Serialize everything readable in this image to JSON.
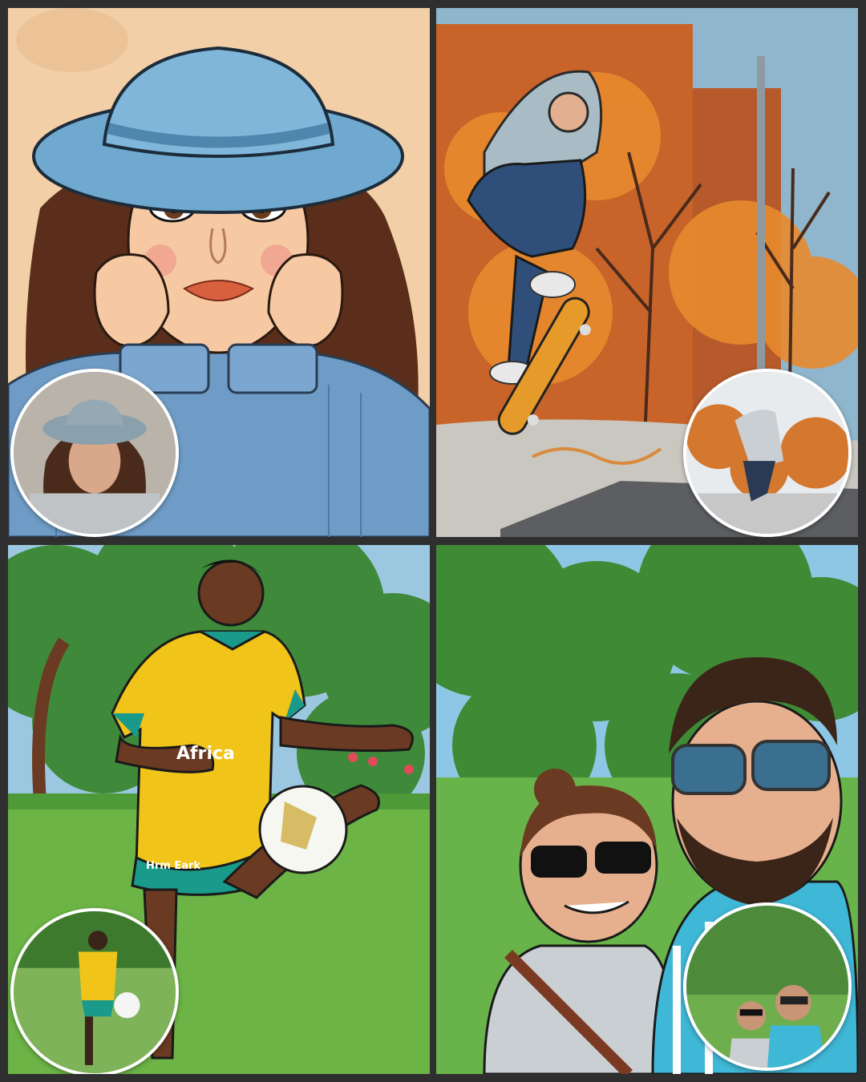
{
  "panels": [
    {
      "subject": "woman-in-blue-hat",
      "background": "#f2cfa6",
      "accent": "#6fa9cf"
    },
    {
      "subject": "skateboarder-autumn",
      "background": "#d9772a",
      "accent": "#a9bcc6"
    },
    {
      "subject": "soccer-player",
      "background": "#5aa23f",
      "accent": "#f0c419",
      "shirt_text": "Africa",
      "shorts_text": "Hrm Eark"
    },
    {
      "subject": "couple-in-park",
      "background": "#4e9a3a",
      "accent": "#3fb7d6"
    }
  ]
}
